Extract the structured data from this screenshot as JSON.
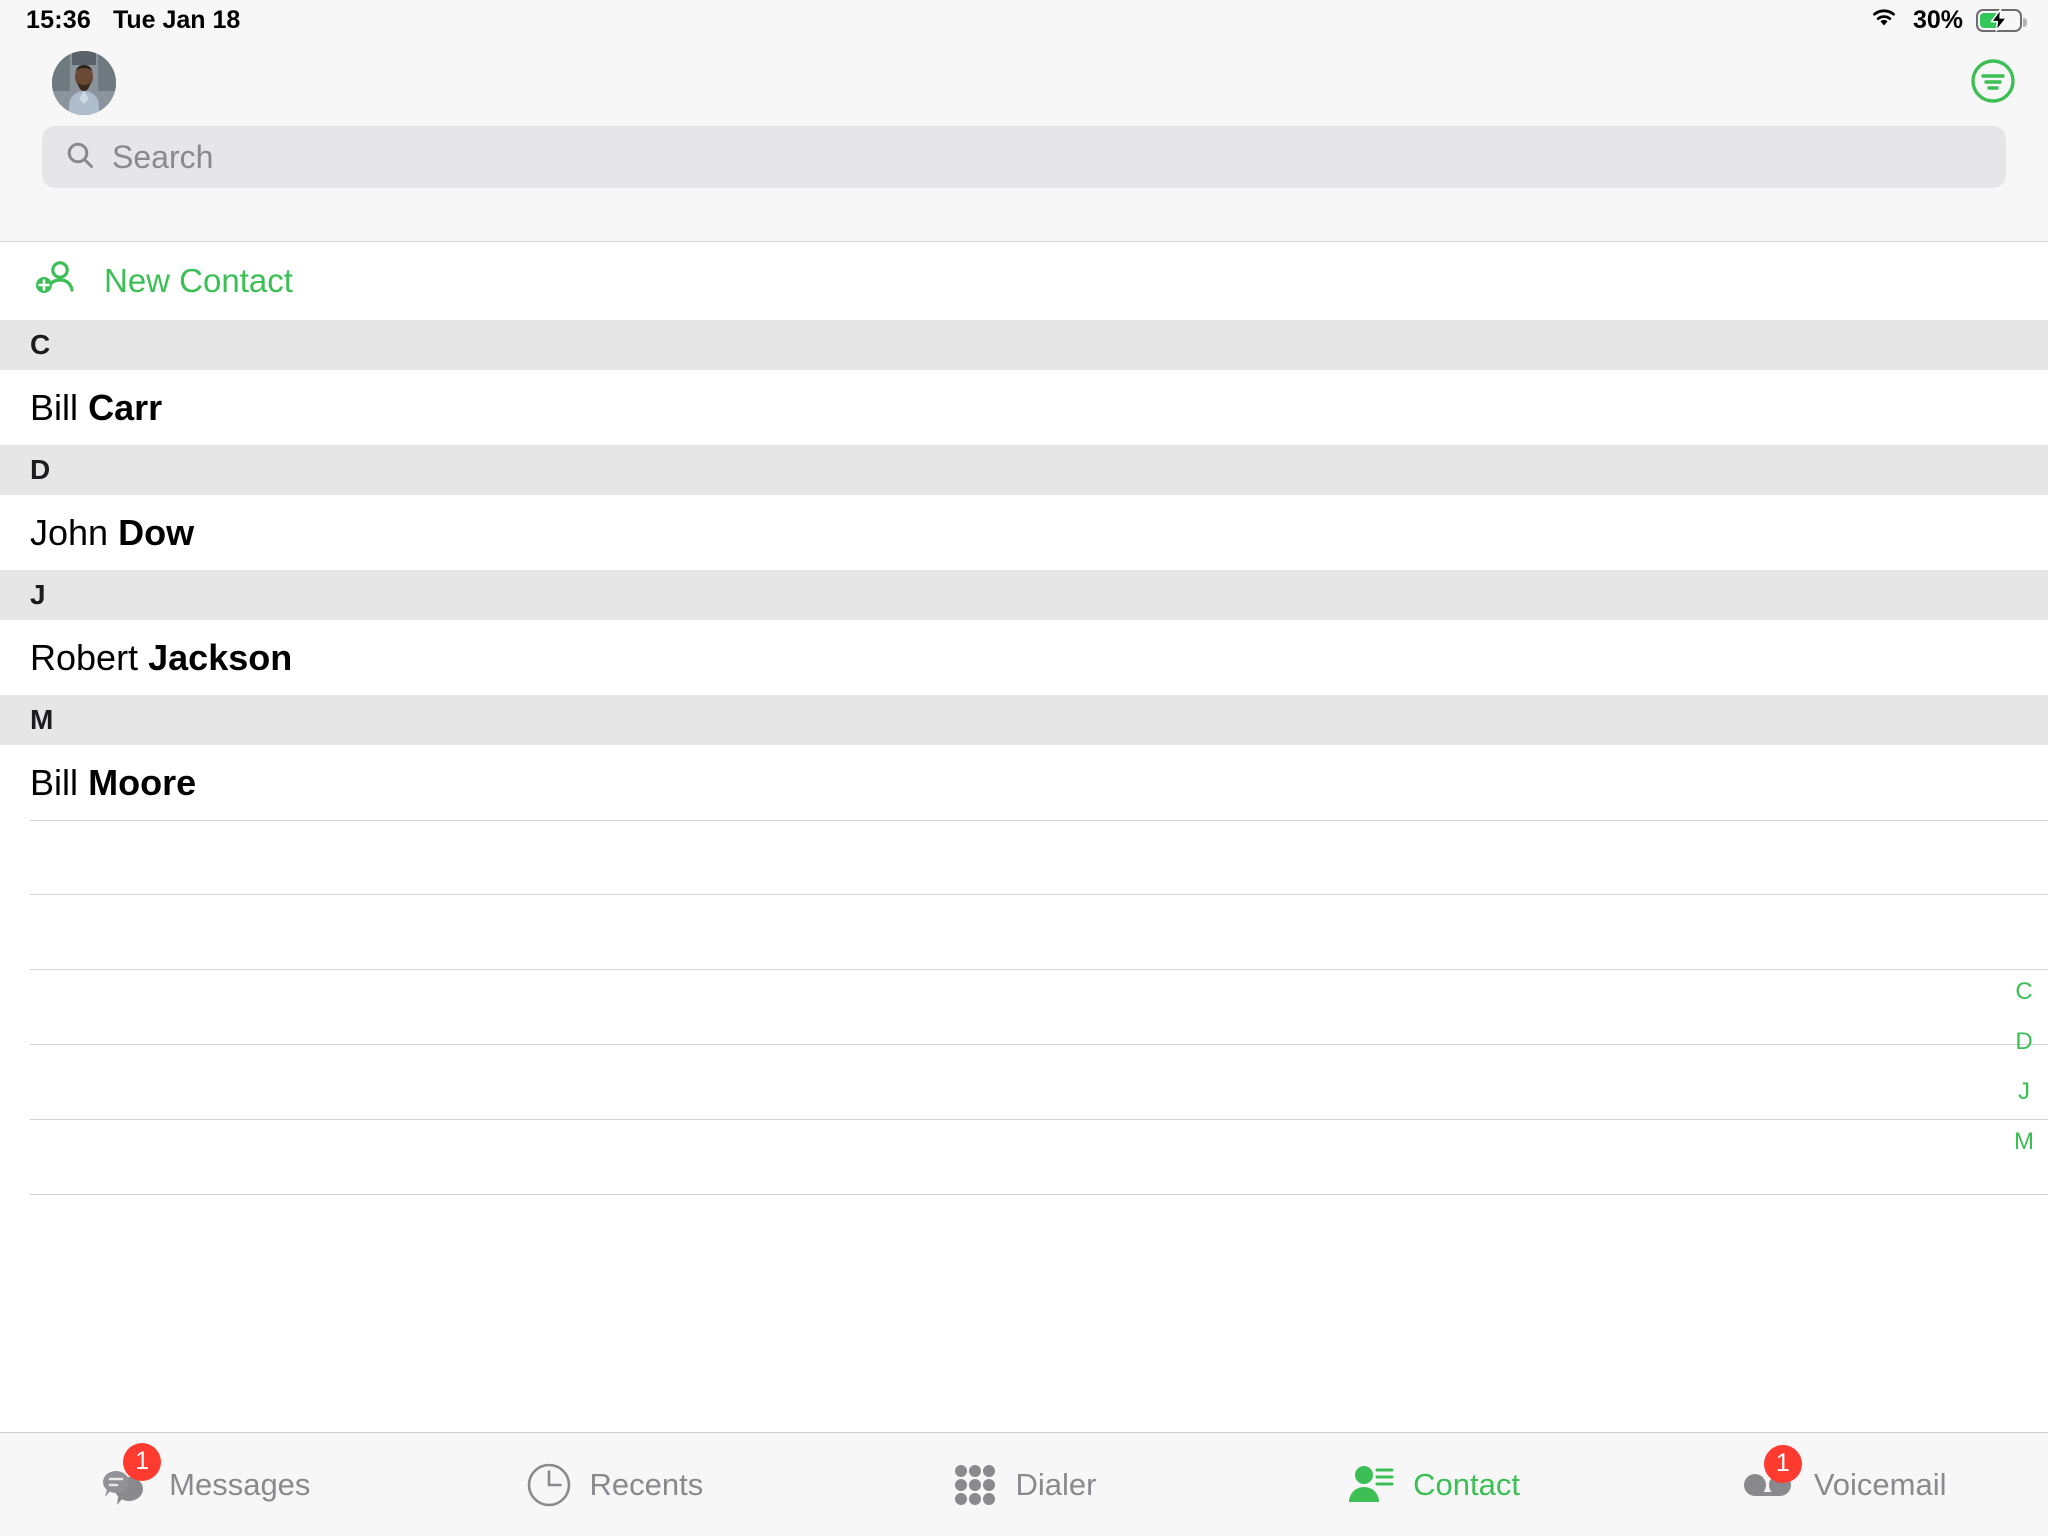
{
  "status_bar": {
    "time": "15:36",
    "date": "Tue Jan 18",
    "battery_percent": "30%",
    "wifi_icon": "wifi-icon",
    "battery_icon": "battery-charging-icon"
  },
  "header": {
    "avatar": "user-avatar",
    "filter_icon": "filter-circle-icon",
    "search": {
      "placeholder": "Search",
      "value": "",
      "icon": "search-icon"
    }
  },
  "new_contact": {
    "label": "New Contact",
    "icon": "person-add-icon"
  },
  "sections": [
    {
      "letter": "C",
      "contacts": [
        {
          "first": "Bill",
          "last": "Carr"
        }
      ]
    },
    {
      "letter": "D",
      "contacts": [
        {
          "first": "John",
          "last": "Dow"
        }
      ]
    },
    {
      "letter": "J",
      "contacts": [
        {
          "first": "Robert",
          "last": "Jackson"
        }
      ]
    },
    {
      "letter": "M",
      "contacts": [
        {
          "first": "Bill",
          "last": "Moore"
        }
      ]
    }
  ],
  "index_strip": [
    "C",
    "D",
    "J",
    "M"
  ],
  "tabs": [
    {
      "label": "Messages",
      "icon": "chat-bubbles-icon",
      "badge": "1",
      "active": false
    },
    {
      "label": "Recents",
      "icon": "clock-icon",
      "badge": "",
      "active": false
    },
    {
      "label": "Dialer",
      "icon": "keypad-grid-icon",
      "badge": "",
      "active": false
    },
    {
      "label": "Contact",
      "icon": "person-list-icon",
      "badge": "",
      "active": true
    },
    {
      "label": "Voicemail",
      "icon": "voicemail-tape-icon",
      "badge": "1",
      "active": false
    }
  ],
  "colors": {
    "accent_green": "#3cbf55",
    "badge_red": "#ff3b30",
    "section_gray": "#e6e6e6",
    "chrome_gray": "#f7f7f7",
    "inactive_gray": "#8a8a8e"
  }
}
